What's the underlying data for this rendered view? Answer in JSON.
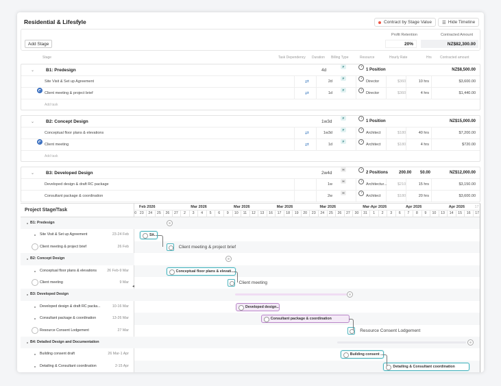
{
  "header": {
    "title": "Residential & Lifestyle",
    "contract_btn": "Contract by Stage Value",
    "hide_timeline_btn": "Hide Timeline"
  },
  "toolbar": {
    "add_stage": "Add Stage",
    "profit_label": "Profit Retention",
    "profit_value": "20%",
    "contracted_label": "Contracted Amount",
    "contracted_value": "NZ$82,300.00"
  },
  "columns": {
    "stage": "Stage",
    "task_dependency": "Task Dependency",
    "duration": "Duration",
    "billing_type": "Billing Type",
    "resource": "Resource",
    "hourly_rate": "Hourly Rate",
    "hrs": "Hrs",
    "contracted_amount": "Contracted amount"
  },
  "stages": [
    {
      "name": "B1: Predesign",
      "duration": "4d",
      "billing": "F",
      "resource": "1 Position",
      "rate": "",
      "hrs": "",
      "amount": "NZ$8,500.00",
      "tasks": [
        {
          "name": "Site Visit & Set up Agreement",
          "duration": "2d",
          "billing": "F",
          "resource": "Director",
          "rate": "$360",
          "hrs": "10 hrs",
          "amount": "$3,600.00"
        },
        {
          "name": "Client meeting & project brief",
          "duration": "1d",
          "billing": "F",
          "resource": "Director",
          "rate": "$360",
          "hrs": "4 hrs",
          "amount": "$1,440.00"
        }
      ],
      "add": "Add task"
    },
    {
      "name": "B2: Concept Design",
      "duration": "1w3d",
      "billing": "F",
      "resource": "1 Position",
      "rate": "",
      "hrs": "",
      "amount": "NZ$15,000.00",
      "tasks": [
        {
          "name": "Conceptual floor plans & elevations",
          "duration": "1w3d",
          "billing": "F",
          "resource": "Architect",
          "rate": "$180",
          "hrs": "40 hrs",
          "amount": "$7,200.00"
        },
        {
          "name": "Client meeting",
          "duration": "1d",
          "billing": "F",
          "resource": "Architect",
          "rate": "$180",
          "hrs": "4 hrs",
          "amount": "$720.00"
        }
      ],
      "add": "Add task"
    },
    {
      "name": "B3: Developed Design",
      "duration": "2w4d",
      "billing": "H",
      "resource": "2 Positions",
      "rate": "200.00",
      "hrs": "50.00",
      "amount": "NZ$12,000.00",
      "tasks": [
        {
          "name": "Developed design & draft RC package",
          "duration": "1w",
          "billing": "H",
          "resource": "Architectur...",
          "rate": "$210",
          "hrs": "15 hrs",
          "amount": "$3,150.00"
        },
        {
          "name": "Consultant package & coordination",
          "duration": "2w",
          "billing": "H",
          "resource": "Architect",
          "rate": "$180",
          "hrs": "20 hrs",
          "amount": "$3,600.00"
        }
      ]
    }
  ],
  "gantt": {
    "left_header": "Project Stage/Task",
    "months": [
      {
        "label": "Feb 2026",
        "i": 0
      },
      {
        "label": "Mar 2026",
        "i": 6
      },
      {
        "label": "Mar 2026",
        "i": 11
      },
      {
        "label": "Mar 2026",
        "i": 16
      },
      {
        "label": "Mar 2026",
        "i": 21
      },
      {
        "label": "Mar-Apr 2026",
        "i": 26
      },
      {
        "label": "Apr 2026",
        "i": 31
      },
      {
        "label": "Apr 2026",
        "i": 36
      },
      {
        "label": "17 Apr",
        "i": 39
      }
    ],
    "days": [
      "23",
      "24",
      "25",
      "26",
      "27",
      "2",
      "3",
      "4",
      "5",
      "6",
      "9",
      "10",
      "11",
      "12",
      "13",
      "16",
      "17",
      "18",
      "19",
      "20",
      "23",
      "24",
      "25",
      "26",
      "27",
      "30",
      "31",
      "1",
      "2",
      "3",
      "6",
      "7",
      "8",
      "9",
      "10",
      "13",
      "14",
      "15",
      "16",
      "17"
    ],
    "rows": [
      {
        "type": "stage",
        "name": "B1: Predesign",
        "date": ""
      },
      {
        "type": "task",
        "name": "Site Visit & Set up Agreement",
        "date": "23-24 Feb"
      },
      {
        "type": "milestone",
        "name": "Client meeting & project brief",
        "date": "26 Feb"
      },
      {
        "type": "stage",
        "name": "B2: Concept Design",
        "date": ""
      },
      {
        "type": "task",
        "name": "Conceptual floor plans & elevations",
        "date": "26 Feb-9 Mar"
      },
      {
        "type": "milestone",
        "name": "Client meeting",
        "date": "9 Mar"
      },
      {
        "type": "stage",
        "name": "B3: Developed Design",
        "date": ""
      },
      {
        "type": "task",
        "name": "Developed design & draft RC packa...",
        "date": "10-16 Mar"
      },
      {
        "type": "task",
        "name": "Consultant package & coordination",
        "date": "13-26 Mar"
      },
      {
        "type": "milestone",
        "name": "Resource Consent Lodgement",
        "date": "27 Mar"
      },
      {
        "type": "stage",
        "name": "B4: Detailed Design and Documentation",
        "date": ""
      },
      {
        "type": "task",
        "name": "Building consent draft",
        "date": "26 Mar-1 Apr"
      },
      {
        "type": "task",
        "name": "Detailing & Consultant coordination",
        "date": "2-15 Apr"
      }
    ],
    "bars": {
      "site": "Sit...",
      "concept": "Conceptual floor plans & elevati...",
      "dev": "Developed design...",
      "consult": "Consultant package & coordination",
      "bc": "Building consent ...",
      "detail": "Detailing & Consultant coordination"
    },
    "mlabels": {
      "cm1": "Client meeting & project brief",
      "cm2": "Client meeting",
      "rc": "Resource Consent Lodgement"
    }
  }
}
